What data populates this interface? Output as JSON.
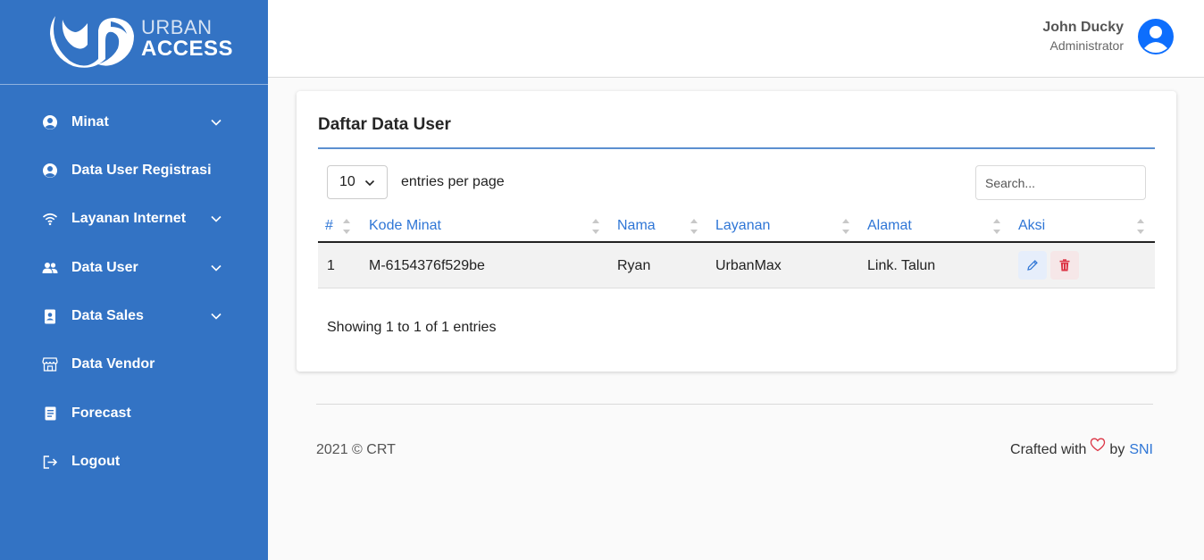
{
  "brand": {
    "top": "URBAN",
    "bottom": "ACCESS"
  },
  "sidebar": {
    "items": [
      {
        "label": "Minat",
        "icon": "user-circle-icon",
        "has_submenu": true
      },
      {
        "label": "Data User Registrasi",
        "icon": "user-circle-icon",
        "has_submenu": false
      },
      {
        "label": "Layanan Internet",
        "icon": "wifi-icon",
        "has_submenu": true
      },
      {
        "label": "Data User",
        "icon": "users-icon",
        "has_submenu": true
      },
      {
        "label": "Data Sales",
        "icon": "contact-book-icon",
        "has_submenu": true
      },
      {
        "label": "Data Vendor",
        "icon": "store-icon",
        "has_submenu": false
      },
      {
        "label": "Forecast",
        "icon": "document-icon",
        "has_submenu": false
      },
      {
        "label": "Logout",
        "icon": "logout-icon",
        "has_submenu": false
      }
    ]
  },
  "header": {
    "user_name": "John Ducky",
    "user_role": "Administrator"
  },
  "card": {
    "title": "Daftar Data User",
    "per_page_value": "10",
    "per_page_label": "entries per page",
    "search_placeholder": "Search...",
    "columns": [
      "#",
      "Kode Minat",
      "Nama",
      "Layanan",
      "Alamat",
      "Aksi"
    ],
    "rows": [
      {
        "no": "1",
        "kode_minat": "M-6154376f529be",
        "nama": "Ryan",
        "layanan": "UrbanMax",
        "alamat": "Link. Talun"
      }
    ],
    "info": "Showing 1 to 1 of 1 entries"
  },
  "footer": {
    "copyright": "2021 © CRT",
    "crafted_prefix": "Crafted with",
    "crafted_by": "by",
    "crafted_author": "SNI"
  },
  "colors": {
    "sidebar": "#3373c4",
    "accent": "#2f76d6",
    "danger": "#dc3545",
    "avatar": "#0d6efd"
  }
}
